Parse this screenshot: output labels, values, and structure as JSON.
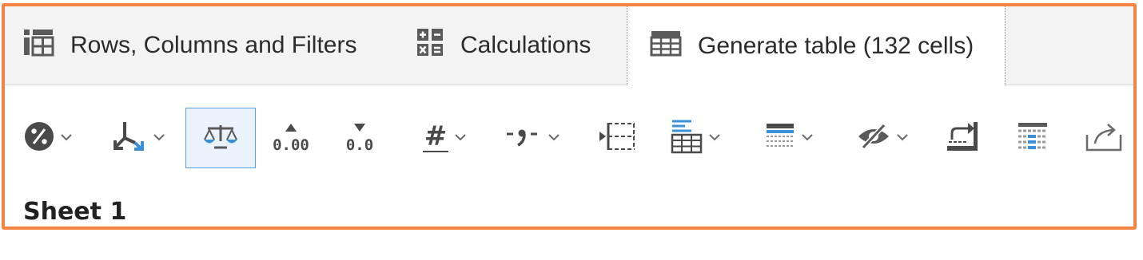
{
  "tabs": [
    {
      "label": "Rows, Columns and Filters",
      "icon": "rows-columns-icon"
    },
    {
      "label": "Calculations",
      "icon": "calculator-icon"
    },
    {
      "label": "Generate table (132 cells)",
      "icon": "table-icon",
      "active": true
    }
  ],
  "toolbar": {
    "decimal_add_label": "0.00",
    "decimal_remove_label": "0.0",
    "number_format_glyph": "#",
    "separator_glyph": "-,-",
    "active_tool": "balance-icon",
    "icons": [
      "percent-icon",
      "merge-arrows-icon",
      "balance-icon",
      "increase-decimals-icon",
      "decrease-decimals-icon",
      "number-format-icon",
      "thousands-separator-icon",
      "insert-column-icon",
      "table-style-icon",
      "header-style-icon",
      "hide-icon",
      "swap-rows-columns-icon",
      "conditional-format-icon",
      "export-icon"
    ]
  },
  "sheet": {
    "title": "Sheet 1"
  },
  "colors": {
    "frame": "#f58342",
    "accent": "#3a90d8",
    "icon": "#4a4a4a",
    "tab_bar": "#f3f3f3"
  }
}
